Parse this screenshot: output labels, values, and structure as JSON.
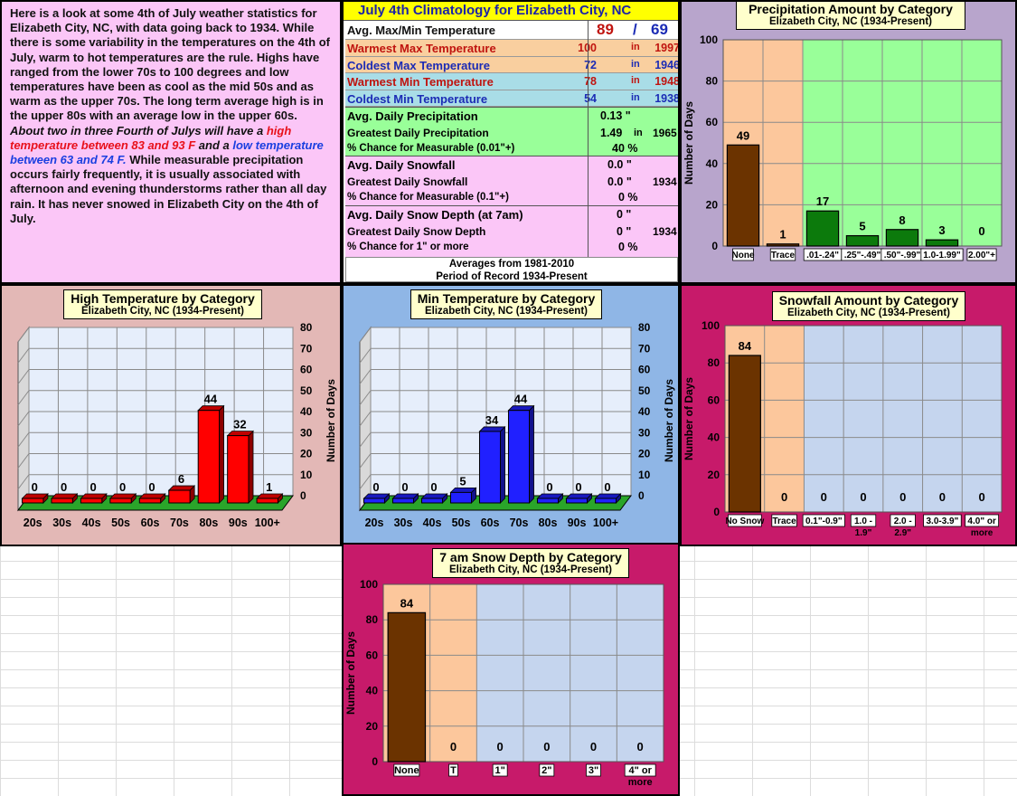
{
  "intro": {
    "p1": "Here is a look at some 4th of July weather statistics for Elizabeth City, NC, with data going back to 1934. While there is some variability in the temperatures on the 4th of July, warm to hot temperatures are the rule. Highs have ranged from the lower 70s to 100 degrees and low temperatures have been as cool as the mid 50s and as warm as the upper 70s.  The long term average high is in the upper 80s with an average low in the upper 60s. ",
    "p2": "About two in three Fourth of Julys will have a ",
    "p3": "high temperature between 83 and 93 F",
    "p4": " and a ",
    "p5": "low temperature between 63 and 74 F.",
    "p6": "  While measurable precipitation occurs fairly frequently, it is usually associated with afternoon and evening thunderstorms rather than all day rain.  It has never snowed in Elizabeth City on the 4th of July."
  },
  "climatology": {
    "title": "July 4th Climatology for Elizabeth City, NC",
    "avg_label": "Avg. Max/Min Temperature",
    "avg_max": "89",
    "avg_slash": "/",
    "avg_min": "69",
    "records": [
      {
        "label": "Warmest Max Temperature",
        "value": "100",
        "in": "in",
        "year": "1997",
        "color": "#c0140f",
        "bg": "#f9cf9f"
      },
      {
        "label": "Coldest Max Temperature",
        "value": "72",
        "in": "in",
        "year": "1946",
        "color": "#1b2bb5",
        "bg": "#f9cf9f"
      },
      {
        "label": "Warmest Min Temperature",
        "value": "78",
        "in": "in",
        "year": "1948",
        "color": "#c0140f",
        "bg": "#a9dde7"
      },
      {
        "label": "Coldest Min Temperature",
        "value": "54",
        "in": "in",
        "year": "1938",
        "color": "#1b2bb5",
        "bg": "#a9dde7"
      }
    ],
    "precip": {
      "avg_label": "Avg. Daily Precipitation",
      "avg_value": "0.13 \"",
      "max_label": "Greatest Daily Precipitation",
      "max_value": "1.49",
      "max_in": "in",
      "max_year": "1965",
      "chance_label": "% Chance for Measurable (0.01\"+)",
      "chance_value": "40  %"
    },
    "snow": {
      "avg_label": "Avg. Daily Snowfall",
      "avg_value": "0.0 \"",
      "max_label": "Greatest Daily Snowfall",
      "max_value": "0.0 \"",
      "max_year": "1934",
      "chance_label": "% Chance for Measurable (0.1\"+)",
      "chance_value": "0  %"
    },
    "depth": {
      "avg_label": "Avg. Daily Snow Depth (at 7am)",
      "avg_value": "0 \"",
      "max_label": "Greatest Daily Snow Depth",
      "max_value": "0 \"",
      "max_year": "1934",
      "chance_label": "% Chance for 1\" or more",
      "chance_value": "0  %"
    },
    "footer1": "Averages from 1981-2010",
    "footer2": "Period of Record 1934-Present"
  },
  "colors": {
    "intro_bg": "#fbc6f7",
    "clim_title_bg": "#ffff00",
    "precip_bg": "#b8a5cc",
    "high_bg": "#e3b8b6",
    "min_bg": "#8fb6e6",
    "snow_bg": "#c71a6a",
    "chart_title_bg": "#ffffcc",
    "trace_zone": "#fcc79c",
    "precip_zone": "#99ff99",
    "snow_zone": "#c5d5ee",
    "bar_brown": "#6b3300",
    "bar_green": "#0c7a0c",
    "bar_red": "#ff0000",
    "bar_blue": "#2020ff",
    "floor_green": "#2aa52a"
  },
  "chart_data": [
    {
      "id": "precip",
      "type": "bar",
      "title": "Precipitation Amount by Category",
      "subtitle": "Elizabeth City, NC (1934-Present)",
      "ylabel": "Number of Days",
      "ylim": [
        0,
        100
      ],
      "yticks": [
        0,
        20,
        40,
        60,
        80,
        100
      ],
      "categories": [
        "None",
        "Trace",
        ".01-.24\"",
        ".25\"-.49\"",
        ".50\"-.99\"",
        "1.0-1.99\"",
        "2.00\"+"
      ],
      "values": [
        49,
        1,
        17,
        5,
        8,
        3,
        0
      ],
      "grid": true
    },
    {
      "id": "high",
      "type": "bar",
      "title": "High Temperature by Category",
      "subtitle": "Elizabeth City, NC (1934-Present)",
      "ylabel": "Number of Days",
      "ylim": [
        0,
        80
      ],
      "yticks": [
        0,
        10,
        20,
        30,
        40,
        50,
        60,
        70,
        80
      ],
      "categories": [
        "20s",
        "30s",
        "40s",
        "50s",
        "60s",
        "70s",
        "80s",
        "90s",
        "100+"
      ],
      "values": [
        0,
        0,
        0,
        0,
        0,
        6,
        44,
        32,
        1
      ],
      "grid": true
    },
    {
      "id": "min",
      "type": "bar",
      "title": "Min Temperature by Category",
      "subtitle": "Elizabeth City, NC (1934-Present)",
      "ylabel": "Number of Days",
      "ylim": [
        0,
        80
      ],
      "yticks": [
        0,
        10,
        20,
        30,
        40,
        50,
        60,
        70,
        80
      ],
      "categories": [
        "20s",
        "30s",
        "40s",
        "50s",
        "60s",
        "70s",
        "80s",
        "90s",
        "100+"
      ],
      "values": [
        0,
        0,
        0,
        5,
        34,
        44,
        0,
        0,
        0
      ],
      "grid": true
    },
    {
      "id": "snowfall",
      "type": "bar",
      "title": "Snowfall Amount  by Category",
      "subtitle": "Elizabeth City, NC (1934-Present)",
      "ylabel": "Number of Days",
      "ylim": [
        0,
        100
      ],
      "yticks": [
        0,
        20,
        40,
        60,
        80,
        100
      ],
      "categories": [
        "No Snow",
        "Trace",
        "0.1\"-0.9\"",
        "1.0 - 1.9\"",
        "2.0 - 2.9\"",
        "3.0-3.9\"",
        "4.0\" or more"
      ],
      "values": [
        84,
        0,
        0,
        0,
        0,
        0,
        0
      ],
      "grid": true
    },
    {
      "id": "depth",
      "type": "bar",
      "title": "7 am Snow Depth by Category",
      "subtitle": "Elizabeth City, NC (1934-Present)",
      "ylabel": "Number of Days",
      "ylim": [
        0,
        100
      ],
      "yticks": [
        0,
        20,
        40,
        60,
        80,
        100
      ],
      "categories": [
        "None",
        "T",
        "1\"",
        "2\"",
        "3\"",
        "4\" or more"
      ],
      "values": [
        84,
        0,
        0,
        0,
        0,
        0
      ],
      "grid": true
    }
  ]
}
